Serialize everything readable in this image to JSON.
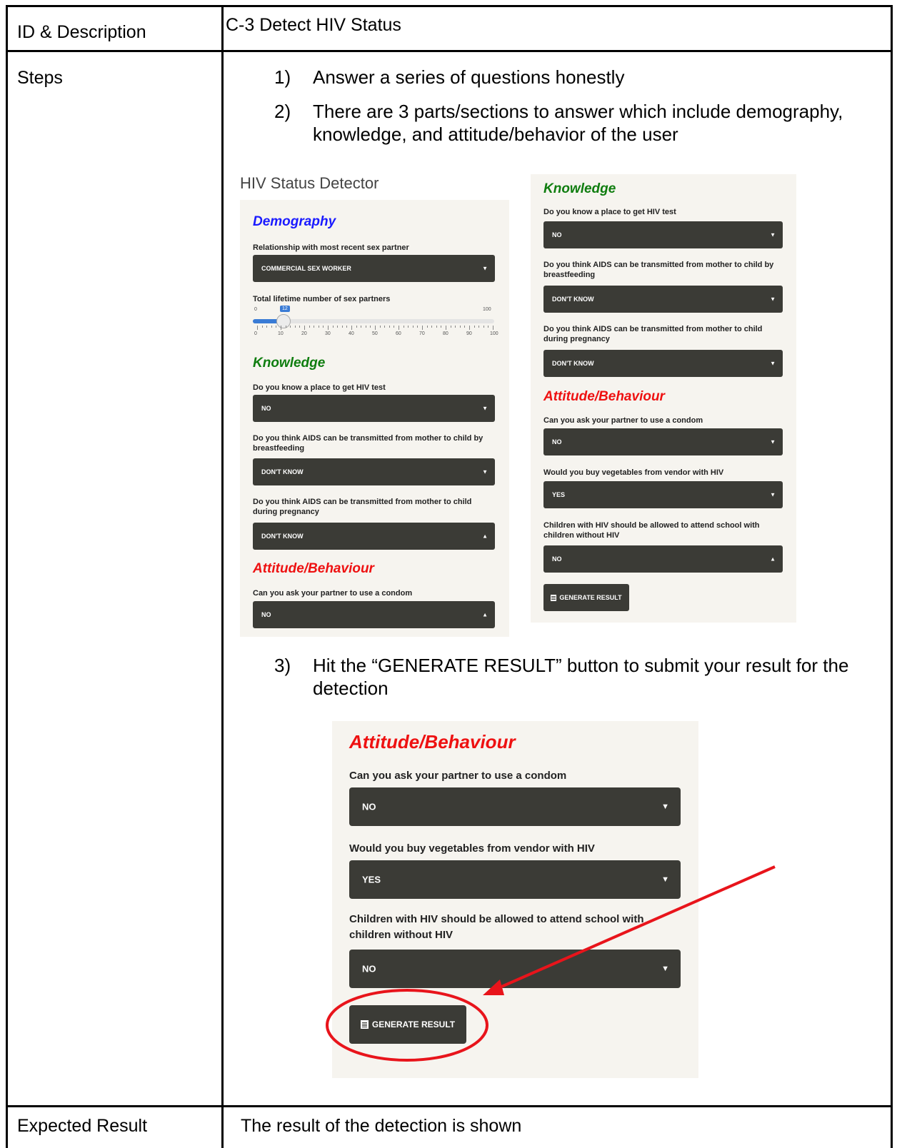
{
  "table": {
    "row1_label": "ID & Description",
    "row1_value": "C-3 Detect HIV Status",
    "row2_label": "Steps",
    "row3_label": "Expected Result",
    "row3_value": "The result of the detection is shown"
  },
  "steps": [
    {
      "num": "1)",
      "text": "Answer a series of questions honestly"
    },
    {
      "num": "2)",
      "text": "There are 3 parts/sections to answer which include demography, knowledge, and attitude/behavior of the user"
    },
    {
      "num": "3)",
      "text": "Hit the “GENERATE RESULT” button to submit your result for the detection"
    }
  ],
  "app": {
    "title": "HIV Status Detector",
    "demography": "Demography",
    "knowledge": "Knowledge",
    "attitude": "Attitude/Behaviour",
    "q_relationship": "Relationship with most recent sex partner",
    "a_relationship": "COMMERCIAL SEX WORKER",
    "q_partners": "Total lifetime number of sex partners",
    "slider": {
      "min": "0",
      "max": "100",
      "value": "12",
      "value_num": 12,
      "ticks": [
        "0",
        "10",
        "20",
        "30",
        "40",
        "50",
        "60",
        "70",
        "80",
        "90",
        "100"
      ]
    },
    "q_place": "Do you know a place to get HIV test",
    "a_place": "NO",
    "q_breast": "Do you think AIDS can be transmitted from mother to child by breastfeeding",
    "a_breast": "DON'T KNOW",
    "q_preg": "Do you think AIDS can be transmitted from mother to child during pregnancy",
    "a_preg": "DON'T KNOW",
    "q_condom": "Can you ask your partner to use a condom",
    "a_condom": "NO",
    "q_veg": "Would you buy vegetables from vendor with HIV",
    "a_veg": "YES",
    "q_school": "Children with HIV should be allowed to attend school with children without HIV",
    "a_school": "NO",
    "generate": "GENERATE RESULT"
  },
  "colors": {
    "demography": "#1a1aff",
    "knowledge": "#0f7d0f",
    "attitude": "#ee1111",
    "select_bg": "#3b3b36",
    "annotation": "#e8141b"
  }
}
